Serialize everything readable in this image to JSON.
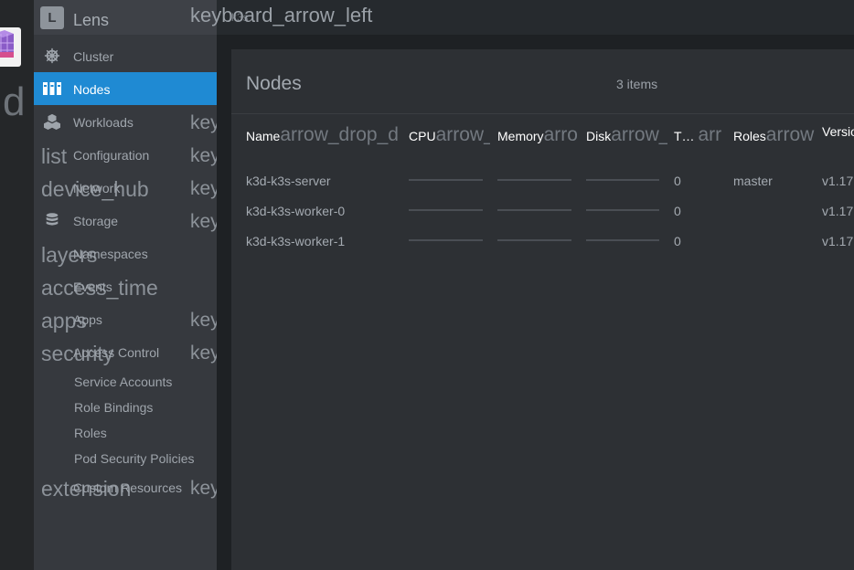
{
  "cluster_strip": {
    "overflow_text": "d"
  },
  "sidebar": {
    "app_name": "Lens",
    "logo_letter": "L",
    "items": [
      {
        "label": "Cluster",
        "icon": "helm-wheel-icon",
        "ligature": "",
        "arrow": ""
      },
      {
        "label": "Nodes",
        "icon": "nodes-icon",
        "ligature": "",
        "arrow": ""
      },
      {
        "label": "Workloads",
        "icon": "cubes-icon",
        "ligature": "",
        "arrow": "key"
      },
      {
        "label": "Configuration",
        "icon": "",
        "ligature": "list",
        "arrow": "key"
      },
      {
        "label": "Network",
        "icon": "",
        "ligature": "device_hub",
        "arrow": "key"
      },
      {
        "label": "Storage",
        "icon": "database-icon",
        "ligature": "",
        "arrow": "key"
      },
      {
        "label": "Namespaces",
        "icon": "",
        "ligature": "layers",
        "arrow": ""
      },
      {
        "label": "Events",
        "icon": "",
        "ligature": "access_time",
        "arrow": ""
      },
      {
        "label": "Apps",
        "icon": "",
        "ligature": "apps",
        "arrow": "key"
      },
      {
        "label": "Access Control",
        "icon": "",
        "ligature": "security",
        "arrow": "key"
      }
    ],
    "sub_items": [
      "Service Accounts",
      "Role Bindings",
      "Roles",
      "Pod Security Policies"
    ],
    "custom_resources": {
      "label": "Custom Resources",
      "ligature": "extension",
      "arrow": "key"
    }
  },
  "topbar": {
    "crumb": "k3s",
    "back_ligature": "keyboard_arrow_left"
  },
  "main": {
    "title": "Nodes",
    "items_count": "3 items",
    "columns": [
      {
        "label": "Name",
        "sort": "arrow_drop_d"
      },
      {
        "label": "CPU",
        "sort": "arrow_"
      },
      {
        "label": "Memory",
        "sort": "arro"
      },
      {
        "label": "Disk",
        "sort": "arrow_"
      },
      {
        "label": "T…",
        "sort": "arr"
      },
      {
        "label": "Roles",
        "sort": "arrow"
      },
      {
        "label": "Versio",
        "sort": ""
      }
    ],
    "rows": [
      {
        "name": "k3d-k3s-server",
        "taints": "0",
        "roles": "master",
        "version": "v1.17",
        "cpu": 0,
        "memory": 0,
        "disk": 0
      },
      {
        "name": "k3d-k3s-worker-0",
        "taints": "0",
        "roles": "",
        "version": "v1.17",
        "cpu": 0,
        "memory": 0,
        "disk": 0
      },
      {
        "name": "k3d-k3s-worker-1",
        "taints": "0",
        "roles": "",
        "version": "v1.17",
        "cpu": 0,
        "memory": 0,
        "disk": 0
      }
    ]
  },
  "colors": {
    "accent": "#1f8ad3",
    "sidebar_bg": "#36393e",
    "panel_bg": "#2d3034"
  }
}
